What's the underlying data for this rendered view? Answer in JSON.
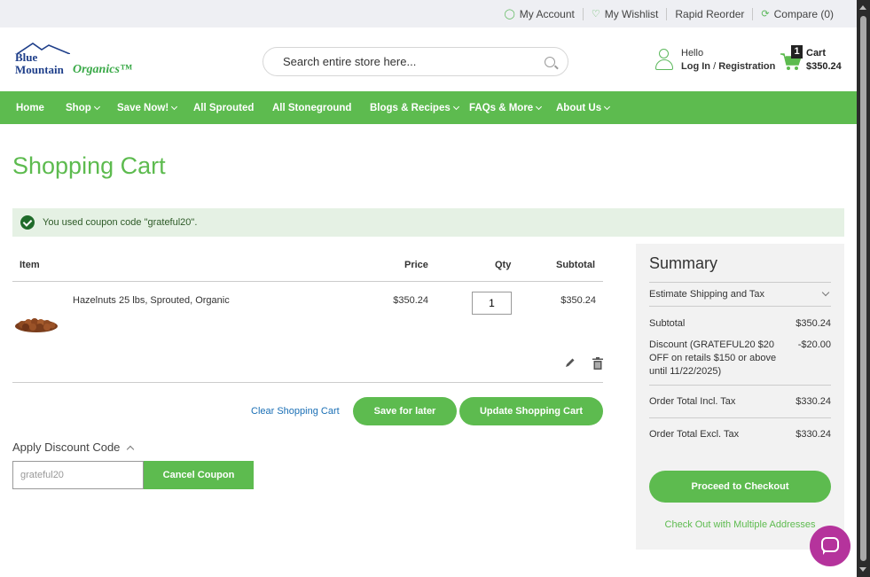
{
  "topbar": {
    "my_account": "My Account",
    "my_wishlist": "My Wishlist",
    "rapid_reorder": "Rapid Reorder",
    "compare": "Compare (0)"
  },
  "header": {
    "logo_line1": "Blue",
    "logo_line2": "Mountain",
    "logo_line3": "Organics™",
    "search_placeholder": "Search entire store here...",
    "hello": "Hello",
    "login": "Log In",
    "separator": "/",
    "registration": "Registration",
    "cart_count": "1",
    "cart_label": "Cart",
    "cart_total": "$350.24"
  },
  "nav": {
    "items": [
      {
        "label": "Home",
        "dropdown": false
      },
      {
        "label": "Shop",
        "dropdown": true
      },
      {
        "label": "Save Now!",
        "dropdown": true
      },
      {
        "label": "All Sprouted",
        "dropdown": false
      },
      {
        "label": "All Stoneground",
        "dropdown": false
      },
      {
        "label": "Blogs & Recipes",
        "dropdown": true
      },
      {
        "label": "FAQs & More",
        "dropdown": true
      },
      {
        "label": "About Us",
        "dropdown": true
      }
    ]
  },
  "page": {
    "title": "Shopping Cart",
    "notice": "You used coupon code \"grateful20\"."
  },
  "table": {
    "headers": {
      "item": "Item",
      "price": "Price",
      "qty": "Qty",
      "subtotal": "Subtotal"
    },
    "rows": [
      {
        "name": "Hazelnuts 25 lbs, Sprouted, Organic",
        "price": "$350.24",
        "qty": "1",
        "subtotal": "$350.24"
      }
    ]
  },
  "actions": {
    "clear": "Clear Shopping Cart",
    "save_for_later": "Save for later",
    "update": "Update Shopping Cart"
  },
  "discount": {
    "title": "Apply Discount Code",
    "code_value": "grateful20",
    "cancel": "Cancel Coupon"
  },
  "summary": {
    "title": "Summary",
    "estimate": "Estimate Shipping and Tax",
    "subtotal_label": "Subtotal",
    "subtotal_value": "$350.24",
    "discount_label": "Discount (GRATEFUL20 $20 OFF on retails $150 or above until 11/22/2025)",
    "discount_value": "-$20.00",
    "total_incl_label": "Order Total Incl. Tax",
    "total_incl_value": "$330.24",
    "total_excl_label": "Order Total Excl. Tax",
    "total_excl_value": "$330.24",
    "checkout": "Proceed to Checkout",
    "multi": "Check Out with Multiple Addresses"
  },
  "colors": {
    "accent": "#5dbb4f",
    "notice_bg": "#e5f1e4",
    "link": "#1a6fb5",
    "chat": "#b5339c"
  }
}
